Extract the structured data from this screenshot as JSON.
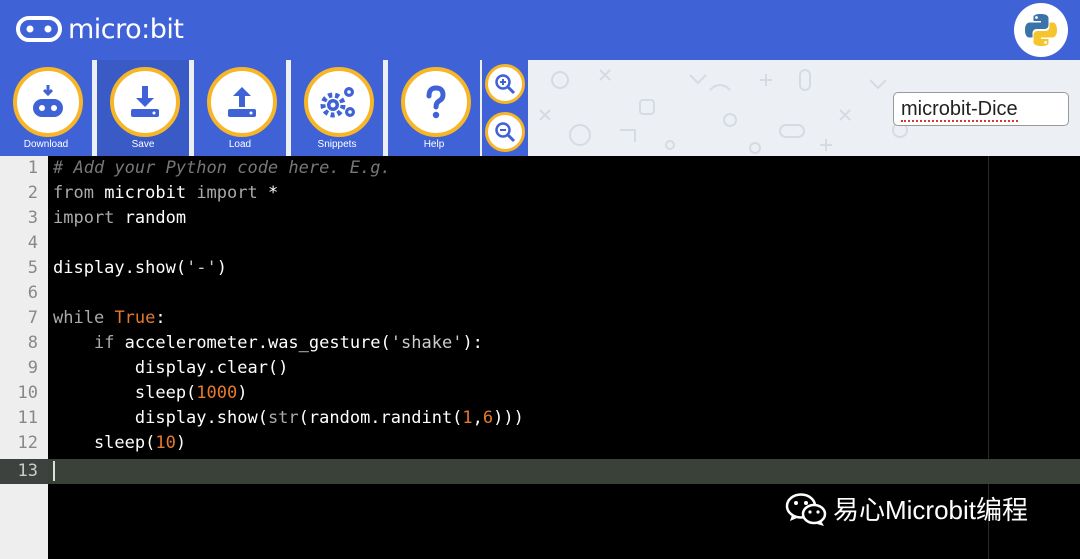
{
  "app": {
    "logo_text": "micro:bit"
  },
  "toolbar": {
    "download_label": "Download",
    "save_label": "Save",
    "load_label": "Load",
    "snippets_label": "Snippets",
    "help_label": "Help"
  },
  "filename": {
    "value": "microbit-Dice"
  },
  "editor": {
    "line_numbers": [
      "1",
      "2",
      "3",
      "4",
      "5",
      "6",
      "7",
      "8",
      "9",
      "10",
      "11",
      "12",
      "13"
    ],
    "active_line": 13,
    "lines": [
      "# Add your Python code here. E.g.",
      "from microbit import *",
      "import random",
      "",
      "display.show('-')",
      "",
      "while True:",
      "    if accelerometer.was_gesture('shake'):",
      "        display.clear()",
      "        sleep(1000)",
      "        display.show(str(random.randint(1,6)))",
      "    sleep(10)",
      ""
    ]
  },
  "watermark": {
    "text": "易心Microbit编程"
  },
  "colors": {
    "brand_blue": "#3f63d6",
    "accent_yellow": "#f6b628",
    "editor_bg": "#000000",
    "number_orange": "#e57a2e"
  },
  "icons": [
    "microbit-logo-icon",
    "python-icon",
    "download-device-icon",
    "save-icon",
    "load-icon",
    "gears-icon",
    "help-icon",
    "zoom-in-icon",
    "zoom-out-icon",
    "wechat-icon"
  ]
}
